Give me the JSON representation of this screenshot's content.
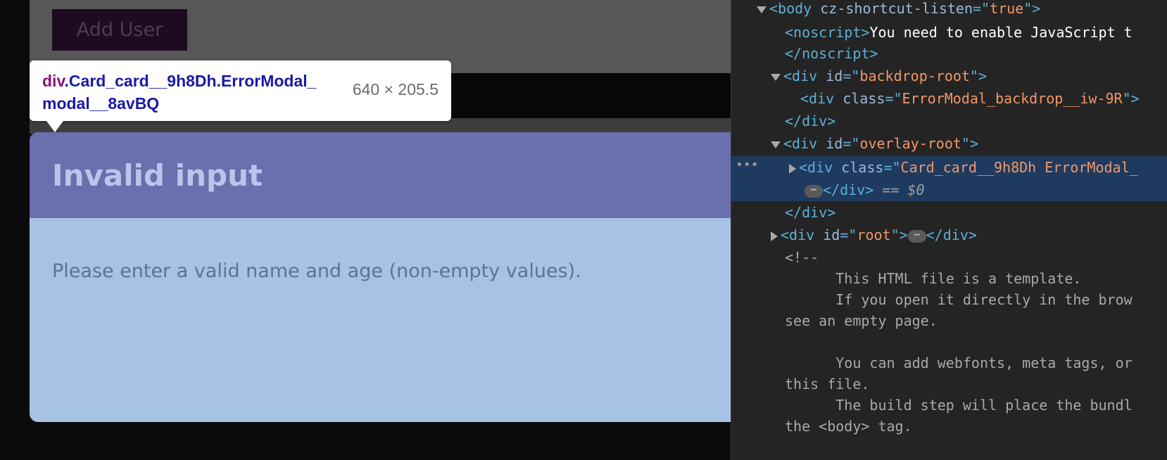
{
  "page": {
    "add_user_button": "Add User",
    "modal": {
      "title": "Invalid input",
      "message": "Please enter a valid name and age (non-empty values)."
    }
  },
  "inspector_tooltip": {
    "tag": "div",
    "selector": ".Card_card__9h8Dh.ErrorModal_modal__8avBQ",
    "size": "640 × 205.5"
  },
  "devtools": {
    "body_tag": "<body ",
    "body_attr": "cz-shortcut-listen",
    "body_attr_eq": "=\"",
    "body_attr_val": "true",
    "body_close": "\">",
    "noscript_open": "<noscript>",
    "noscript_text": "You need to enable JavaScript t",
    "noscript_close": "</noscript>",
    "div_open": "<div ",
    "id_attr": "id",
    "class_attr": "class",
    "backdrop_root": "backdrop-root",
    "backdrop_class": "ErrorModal_backdrop__iw-9R",
    "div_close": "</div>",
    "overlay_root": "overlay-root",
    "card_class": "Card_card__9h8Dh ErrorModal_",
    "selected_suffix": "== $0",
    "root_id": "root",
    "ellipsis": "⋯",
    "comment_open": "<!--",
    "comment_lines": [
      "      This HTML file is a template.",
      "      If you open it directly in the brow",
      "see an empty page.",
      "",
      "      You can add webfonts, meta tags, or",
      "this file.",
      "      The build step will place the bundl",
      "the <body> tag."
    ]
  }
}
